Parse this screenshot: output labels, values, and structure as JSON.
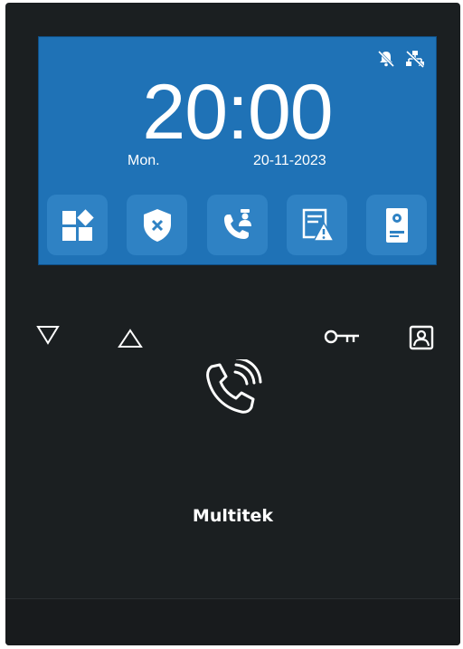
{
  "screen": {
    "time": "20:00",
    "day": "Mon.",
    "date": "20-11-2023",
    "status_icons": [
      "bell-muted-icon",
      "network-disconnected-icon"
    ],
    "tiles": [
      {
        "icon": "apps-grid-icon"
      },
      {
        "icon": "security-shield-icon"
      },
      {
        "icon": "call-guard-icon"
      },
      {
        "icon": "alarm-warning-icon"
      },
      {
        "icon": "door-station-icon"
      }
    ]
  },
  "hardware_buttons": [
    "down-arrow-icon",
    "up-arrow-icon",
    "key-unlock-icon",
    "monitor-contact-icon",
    "phone-call-icon"
  ],
  "brand": {
    "logo_text": "Multitek"
  },
  "colors": {
    "body": "#1b1f21",
    "screen": "#1f72b6",
    "tile": "#2f82c4",
    "icon": "#ffffff"
  }
}
